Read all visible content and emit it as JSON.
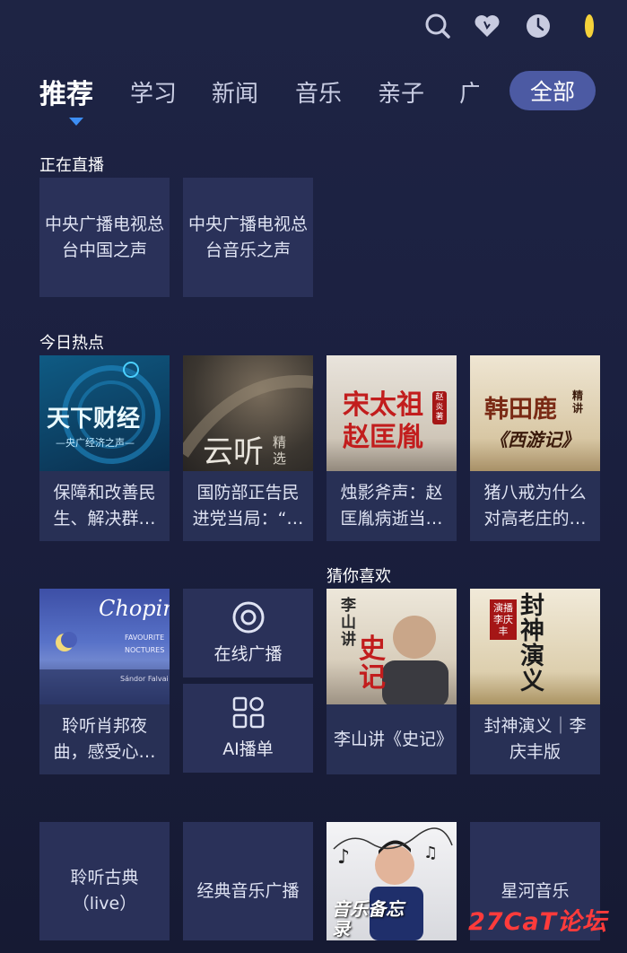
{
  "header": {
    "icons": [
      "search-icon",
      "heart-icon",
      "history-icon",
      "avatar"
    ]
  },
  "tabs": [
    {
      "label": "推荐",
      "active": true
    },
    {
      "label": "学习"
    },
    {
      "label": "新闻"
    },
    {
      "label": "音乐"
    },
    {
      "label": "亲子"
    },
    {
      "label": "广"
    }
  ],
  "all_tab": "全部",
  "live": {
    "title": "正在直播",
    "items": [
      "中央广播电视总台中国之声",
      "中央广播电视总台音乐之声"
    ]
  },
  "hot": {
    "title": "今日热点",
    "items": [
      {
        "cover_text": "天下财经",
        "cover_sub": "—央广经济之声—",
        "caption": "保障和改善民生、解决群众急难愁盼问题"
      },
      {
        "cover_text": "云听",
        "cover_sub": "精选",
        "caption": "国防部正告民进党当局：“以武谋独”是死路一条"
      },
      {
        "cover_text": "宋太祖",
        "cover_text2": "赵匡胤",
        "cover_badge": "赵炎著",
        "caption": "烛影斧声：赵匡胤病逝当夜之谜"
      },
      {
        "cover_text": "韩田鹿",
        "cover_text2": "《西游记》",
        "cover_badge": "精讲",
        "caption": "猪八戒为什么对高老庄的媳妇念念不忘"
      }
    ]
  },
  "left_grid": {
    "chopin": {
      "cover_text": "Chopin",
      "cover_sub1": "FAVOURITE",
      "cover_sub2": "NOCTURES",
      "cover_author": "Sándor Falvai",
      "caption": "聆听肖邦夜曲，感受心灵的宁静"
    },
    "services": [
      {
        "label": "在线广播",
        "icon": "radio-icon"
      },
      {
        "label": "AI播单",
        "icon": "grid-apps-icon"
      }
    ]
  },
  "guess": {
    "title": "猜你喜欢",
    "items": [
      {
        "cover_text": "李山讲",
        "cover_text2": "史记",
        "caption": "李山讲《史记》"
      },
      {
        "cover_text": "封神演义",
        "cover_badge": "演播 李庆丰",
        "caption": "封神演义｜李庆丰版"
      }
    ]
  },
  "bottom": {
    "items": [
      {
        "caption": "聆听古典（live）"
      },
      {
        "caption": "经典音乐广播"
      },
      {
        "cover_text": "音乐备忘录",
        "caption": ""
      },
      {
        "caption": "星河音乐"
      }
    ]
  },
  "watermark": "27CaT论坛"
}
